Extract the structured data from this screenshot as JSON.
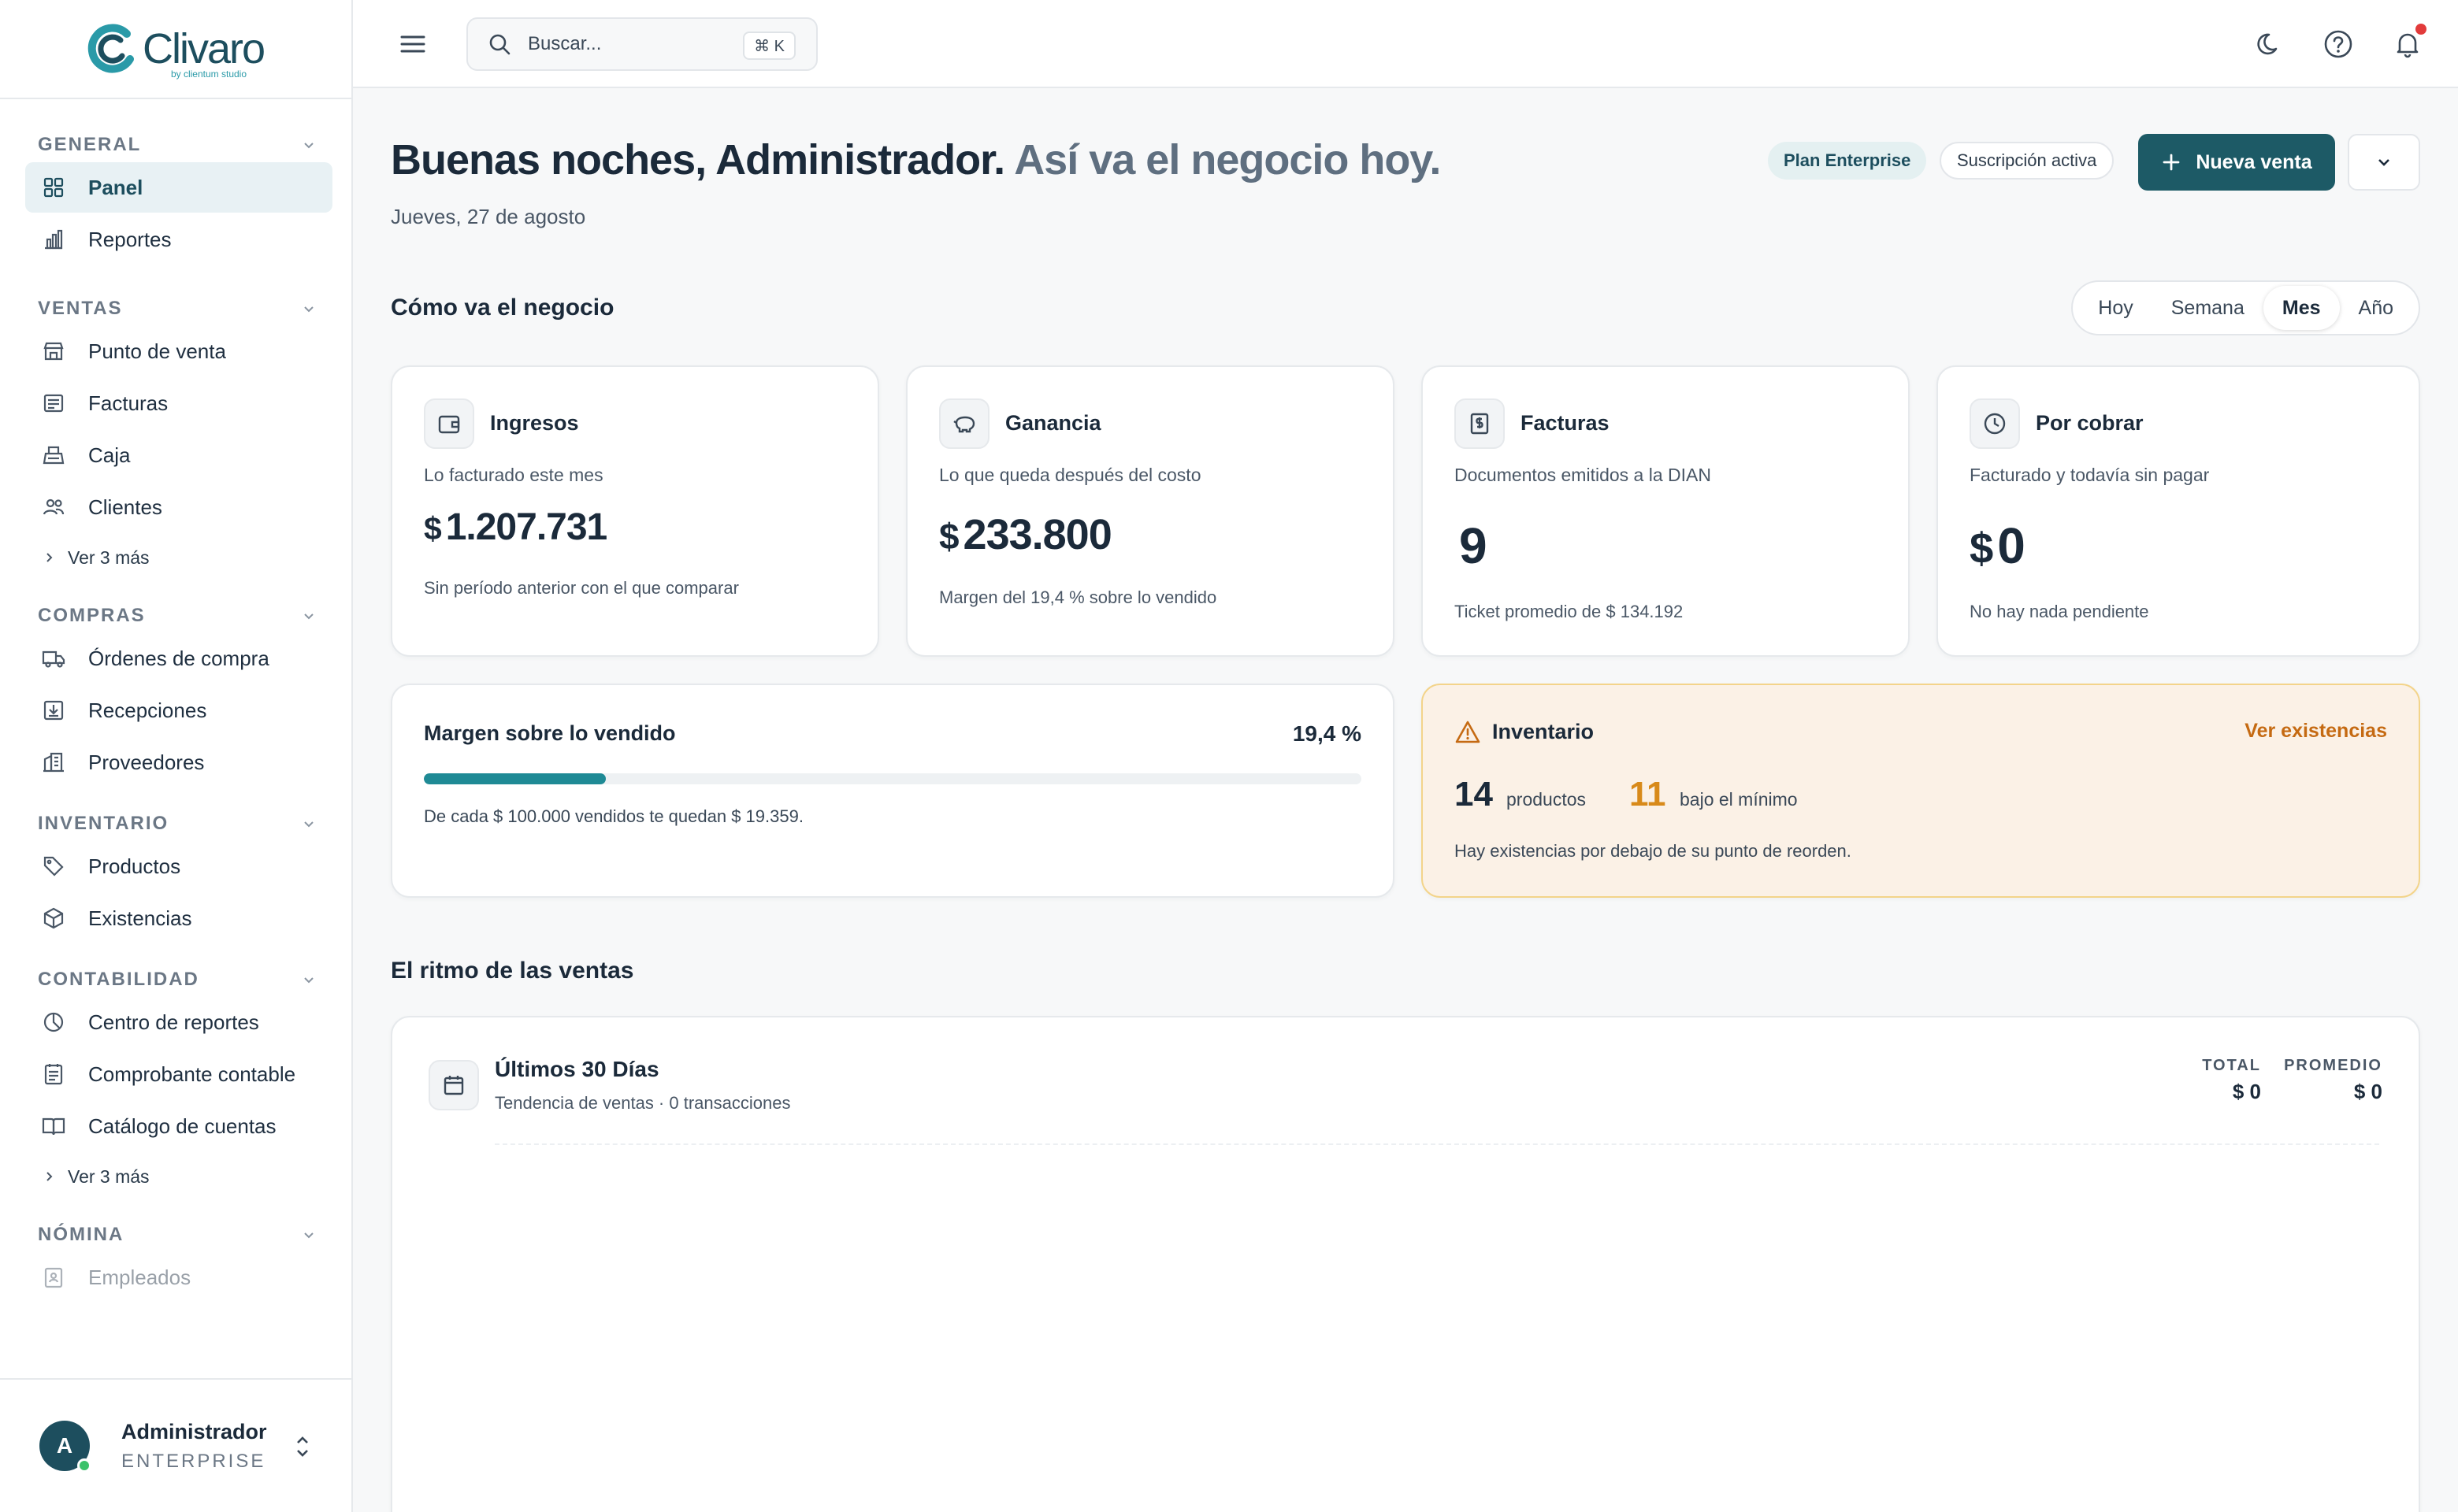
{
  "app": {
    "logo_text": "Clivaro",
    "logo_sub": "by clientum studio"
  },
  "sidebar": {
    "sections": [
      {
        "title": "GENERAL",
        "items": [
          {
            "label": "Panel",
            "icon": "grid-icon",
            "active": true
          },
          {
            "label": "Reportes",
            "icon": "bar-chart-icon"
          }
        ]
      },
      {
        "title": "VENTAS",
        "items": [
          {
            "label": "Punto de venta",
            "icon": "store-icon"
          },
          {
            "label": "Facturas",
            "icon": "invoice-icon"
          },
          {
            "label": "Caja",
            "icon": "cash-register-icon"
          },
          {
            "label": "Clientes",
            "icon": "users-icon"
          }
        ],
        "more": "Ver 3 más"
      },
      {
        "title": "COMPRAS",
        "items": [
          {
            "label": "Órdenes de compra",
            "icon": "truck-icon"
          },
          {
            "label": "Recepciones",
            "icon": "download-box-icon"
          },
          {
            "label": "Proveedores",
            "icon": "building-icon"
          }
        ]
      },
      {
        "title": "INVENTARIO",
        "items": [
          {
            "label": "Productos",
            "icon": "tag-icon"
          },
          {
            "label": "Existencias",
            "icon": "package-icon"
          }
        ]
      },
      {
        "title": "CONTABILIDAD",
        "items": [
          {
            "label": "Centro de reportes",
            "icon": "pie-chart-icon"
          },
          {
            "label": "Comprobante contable",
            "icon": "receipt-icon"
          },
          {
            "label": "Catálogo de cuentas",
            "icon": "book-icon"
          }
        ],
        "more": "Ver 3 más"
      },
      {
        "title": "NÓMINA",
        "items": [
          {
            "label": "Empleados",
            "icon": "id-card-icon"
          }
        ]
      }
    ],
    "user": {
      "initial": "A",
      "name": "Administrador",
      "role": "ENTERPRISE"
    }
  },
  "topbar": {
    "search_placeholder": "Buscar...",
    "shortcut": "⌘ K"
  },
  "header": {
    "greeting": "Buenas noches, Administrador.",
    "greeting_muted": "Así va el negocio hoy.",
    "date": "Jueves, 27 de agosto",
    "plan_badge": "Plan Enterprise",
    "subscription_badge": "Suscripción activa",
    "new_sale_label": "Nueva venta"
  },
  "business": {
    "title": "Cómo va el negocio",
    "periods": [
      "Hoy",
      "Semana",
      "Mes",
      "Año"
    ],
    "active_period": "Mes",
    "kpis": [
      {
        "title": "Ingresos",
        "desc": "Lo facturado este mes",
        "currency": "$",
        "value": "1.207.731",
        "note": "Sin período anterior con el que comparar",
        "icon": "wallet-icon"
      },
      {
        "title": "Ganancia",
        "desc": "Lo que queda después del costo",
        "currency": "$",
        "value": "233.800",
        "note": "Margen del 19,4 % sobre lo vendido",
        "icon": "piggy-bank-icon"
      },
      {
        "title": "Facturas",
        "desc": "Documentos emitidos a la DIAN",
        "currency": "",
        "value": "9",
        "note": "Ticket promedio de $ 134.192",
        "icon": "document-dollar-icon"
      },
      {
        "title": "Por cobrar",
        "desc": "Facturado y todavía sin pagar",
        "currency": "$",
        "value": "0",
        "note": "No hay nada pendiente",
        "icon": "clock-icon"
      }
    ],
    "margin": {
      "title": "Margen sobre lo vendido",
      "pct_label": "19,4 %",
      "fraction": 0.194,
      "note": "De cada $ 100.000 vendidos te quedan $ 19.359."
    },
    "inventory": {
      "title": "Inventario",
      "link": "Ver existencias",
      "products_count": "14",
      "products_label": "productos",
      "below_min_count": "11",
      "below_min_label": "bajo el mínimo",
      "note": "Hay existencias por debajo de su punto de reorden."
    }
  },
  "sales_rhythm": {
    "title": "El ritmo de las ventas",
    "chart_title": "Últimos 30 Días",
    "chart_sub": "Tendencia de ventas · 0 transacciones",
    "total_label": "TOTAL",
    "total_value": "$ 0",
    "avg_label": "PROMEDIO",
    "avg_value": "$ 0"
  },
  "colors": {
    "primary": "#1d5a66",
    "accent_teal": "#1f8a95",
    "warning": "#c56a12",
    "notification": "#e23b3b"
  }
}
